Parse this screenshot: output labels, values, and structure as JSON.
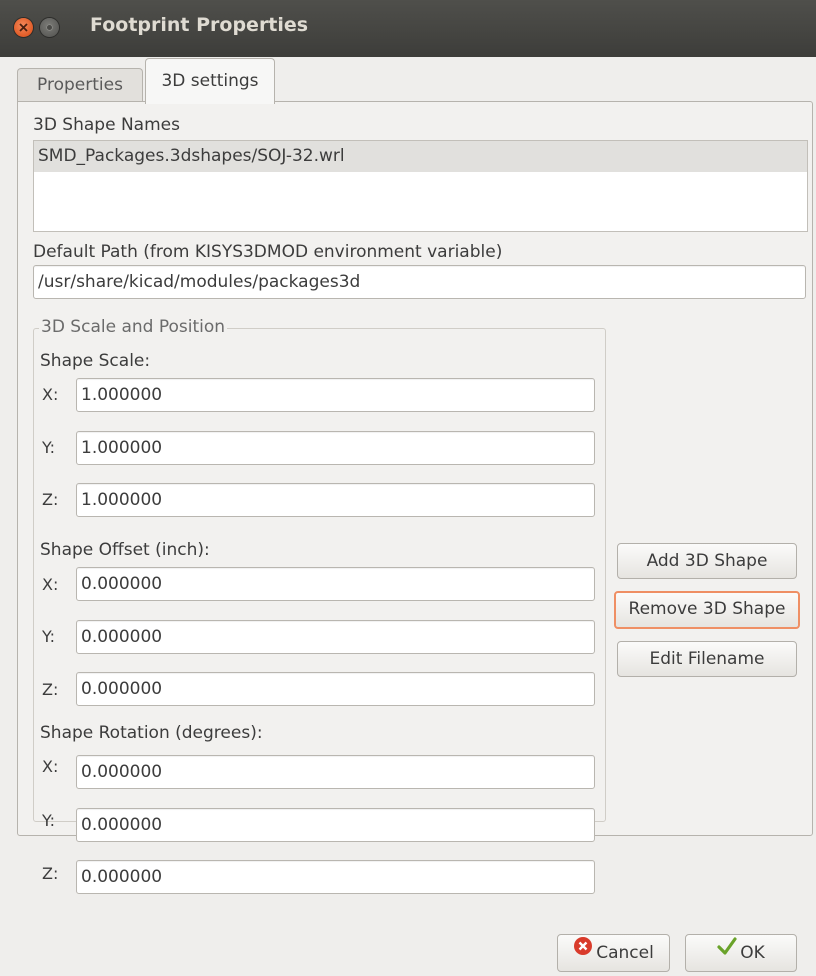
{
  "window": {
    "title": "Footprint Properties"
  },
  "tabs": [
    {
      "label": "Properties"
    },
    {
      "label": "3D settings"
    }
  ],
  "shape_names": {
    "label": "3D Shape Names",
    "items": [
      "SMD_Packages.3dshapes/SOJ-32.wrl"
    ]
  },
  "default_path": {
    "label": "Default Path (from KISYS3DMOD environment variable)",
    "value": "/usr/share/kicad/modules/packages3d"
  },
  "scale_position": {
    "title": "3D Scale and Position",
    "scale": {
      "label": "Shape Scale:",
      "x": "1.000000",
      "y": "1.000000",
      "z": "1.000000"
    },
    "offset": {
      "label": "Shape Offset (inch):",
      "x": "0.000000",
      "y": "0.000000",
      "z": "0.000000"
    },
    "rotation": {
      "label": "Shape Rotation (degrees):",
      "x": "0.000000",
      "y": "0.000000",
      "z": "0.000000"
    },
    "axis_labels": {
      "x": "X:",
      "y": "Y:",
      "z": "Z:"
    }
  },
  "actions": {
    "add": "Add 3D Shape",
    "remove": "Remove 3D Shape",
    "edit": "Edit Filename"
  },
  "footer": {
    "cancel": "Cancel",
    "ok": "OK"
  },
  "colors": {
    "titlebar": "#3d3d3a",
    "close_button": "#e05b26",
    "focus_border": "#ef8f64",
    "cancel_icon": "#d93b2b",
    "ok_icon": "#6aa32a"
  },
  "icons": {
    "close": "close-icon",
    "minimize": "minimize-icon",
    "cancel": "cancel-icon",
    "ok": "checkmark-icon"
  }
}
